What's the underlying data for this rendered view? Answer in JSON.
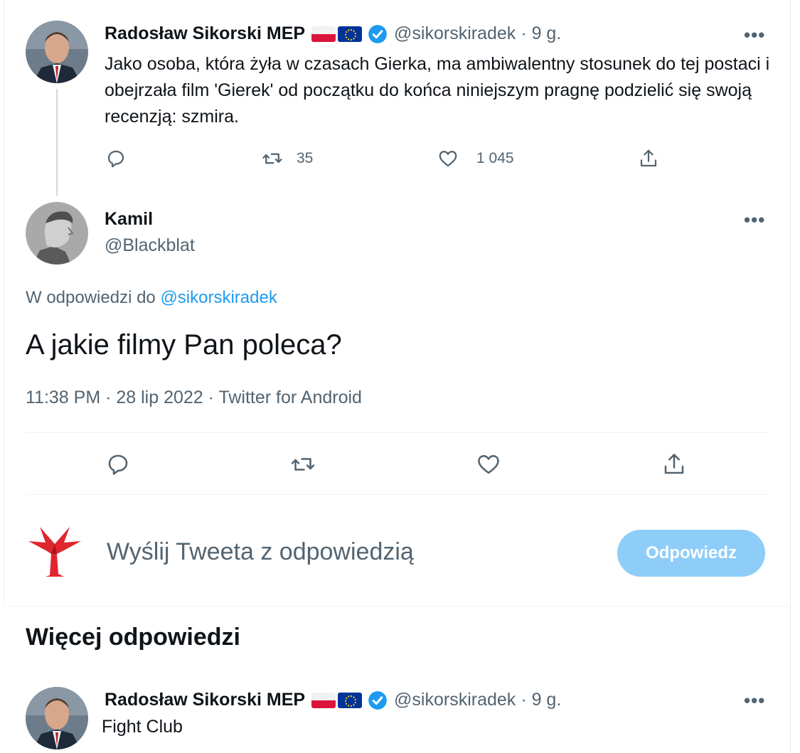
{
  "tweet1": {
    "name": "Radosław Sikorski MEP",
    "handle": "@sikorskiradek",
    "time": "· 9 g.",
    "text": "Jako osoba, która żyła w czasach Gierka, ma ambiwalentny stosunek do tej postaci i obejrzała film 'Gierek' od początku do końca niniejszym pragnę podzielić się swoją recenzją: szmira.",
    "retweets": "35",
    "likes": "1 045"
  },
  "main_tweet": {
    "name": "Kamil",
    "handle": "@Blackblat",
    "reply_prefix": "W odpowiedzi do",
    "reply_mention": "@sikorskiradek",
    "text": "A jakie filmy Pan poleca?",
    "meta": "11:38 PM · 28 lip 2022 · Twitter for Android"
  },
  "composer": {
    "placeholder": "Wyślij Tweeta z odpowiedzią",
    "button_label": "Odpowiedz"
  },
  "more_replies": {
    "title": "Więcej odpowiedzi",
    "reply": {
      "name": "Radosław Sikorski MEP",
      "handle": "@sikorskiradek",
      "time": "· 9 g.",
      "text": "Fight Club"
    }
  },
  "menu_glyph": "•••",
  "icons": [
    "reply-icon",
    "retweet-icon",
    "like-icon",
    "share-icon",
    "verified-icon",
    "more-icon",
    "flag-pl-icon",
    "flag-eu-icon"
  ],
  "colors": {
    "accent": "#1d9bf0",
    "button_disabled": "#8ecdf8",
    "secondary_text": "#536471"
  }
}
